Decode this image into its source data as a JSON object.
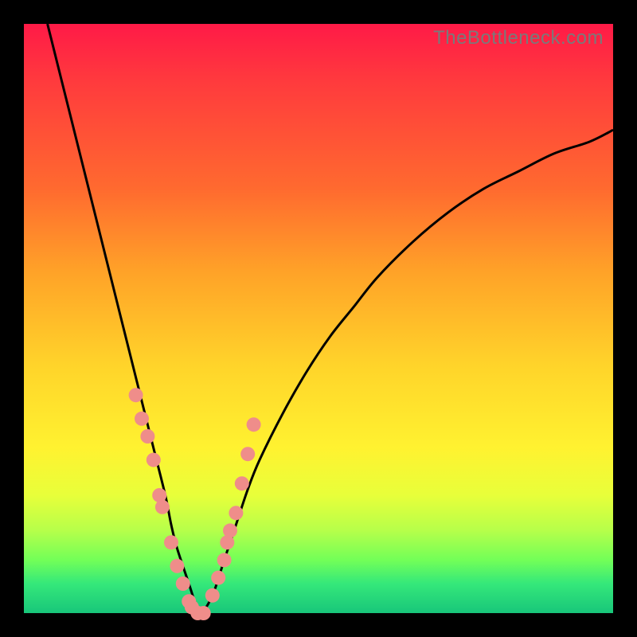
{
  "watermark": "TheBottleneck.com",
  "chart_data": {
    "type": "line",
    "title": "",
    "xlabel": "",
    "ylabel": "",
    "xlim": [
      0,
      100
    ],
    "ylim": [
      0,
      100
    ],
    "grid": false,
    "legend": false,
    "series": [
      {
        "name": "black-curve",
        "type": "line",
        "color": "#000000",
        "x": [
          4,
          6,
          8,
          10,
          12,
          14,
          16,
          18,
          20,
          22,
          24,
          25,
          26,
          28,
          29,
          30,
          32,
          34,
          36,
          38,
          40,
          44,
          48,
          52,
          56,
          60,
          66,
          72,
          78,
          84,
          90,
          96,
          100
        ],
        "y": [
          100,
          92,
          84,
          76,
          68,
          60,
          52,
          44,
          36,
          28,
          20,
          15,
          11,
          5,
          2,
          0,
          3,
          9,
          15,
          21,
          26,
          34,
          41,
          47,
          52,
          57,
          63,
          68,
          72,
          75,
          78,
          80,
          82
        ]
      },
      {
        "name": "pink-dots",
        "type": "scatter",
        "color": "#ef8d8a",
        "x": [
          19.0,
          20.0,
          21.0,
          22.0,
          23.0,
          23.5,
          25.0,
          26.0,
          27.0,
          28.0,
          28.5,
          29.5,
          30.5,
          32.0,
          33.0,
          34.0,
          34.5,
          35.0,
          36.0,
          37.0,
          38.0,
          39.0
        ],
        "y": [
          37,
          33,
          30,
          26,
          20,
          18,
          12,
          8,
          5,
          2,
          1,
          0,
          0,
          3,
          6,
          9,
          12,
          14,
          17,
          22,
          27,
          32
        ]
      }
    ],
    "annotations": []
  }
}
